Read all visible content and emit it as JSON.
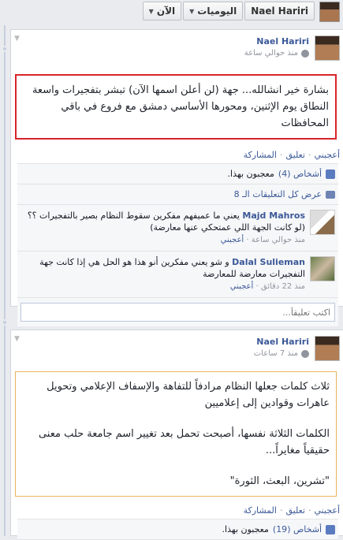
{
  "topbar": {
    "profile_name": "Nael Hariri",
    "menu_diaries": "اليوميات",
    "menu_now": "الآن"
  },
  "posts": [
    {
      "author": "Nael Hariri",
      "time": "منذ حوالي ساعة",
      "text": "بشارة خير انشالله... جهة (لن أعلن اسمها الآن) تبشر بتفجيرات واسعة النطاق يوم الإثنين، ومحورها الأساسي دمشق مع فروع في باقي المحافظات",
      "actions": {
        "like": "أعجبني",
        "comment": "تعليق",
        "share": "المشاركة"
      },
      "likes": "أشخاص (4) معجبون بهذا.",
      "likes_count_link": "أشخاص (4)",
      "likes_rest": "معجبون بهذا.",
      "view_all": "عرض كل التعليقات الـ 8",
      "comments": [
        {
          "name": "Majd Mahros",
          "text": "يعني ما عميفهم مفكرين سقوط النظام بصير بالتفجيرات ؟؟ (لو كانت الجهة اللي عمتحكي عنها معارضة)",
          "time": "منذ حوالي ساعة",
          "like": "أعجبني"
        },
        {
          "name": "Dalal Sulieman",
          "text": "و شو يعني مفكرين أنو هذا هو الحل هي إذا كانت جهة التفجيرات معارضة للمعارضة",
          "time": "منذ 22 دقائق",
          "like": "أعجبني"
        }
      ],
      "write_placeholder": "اكتب تعليقاً..."
    },
    {
      "author": "Nael Hariri",
      "time": "منذ 7 ساعات",
      "text_lines": [
        "ثلاث كلمات جعلها النظام مرادفاً للتفاهة والإسفاف الإعلامي وتحويل عاهرات وقوادين إلى إعلاميين",
        "الكلمات الثلاثة نفسها، أصبحت تحمل بعد تغيير اسم جامعة حلب معنى حقيقياً مغايراً...",
        "\"تشرين، البعث، الثورة\""
      ],
      "actions": {
        "like": "أعجبني",
        "comment": "تعليق",
        "share": "المشاركة"
      },
      "likes_count_link": "أشخاص (19)",
      "likes_rest": "معجبون بهذا."
    }
  ],
  "colors": {
    "link": "#3b5998",
    "highlight_red": "#d8232a",
    "highlight_orange": "#e9b45c"
  },
  "icons": [
    "profile-avatar",
    "caret-down-icon",
    "globe-icon",
    "like-icon",
    "comment-icon",
    "chevron-down-icon"
  ]
}
